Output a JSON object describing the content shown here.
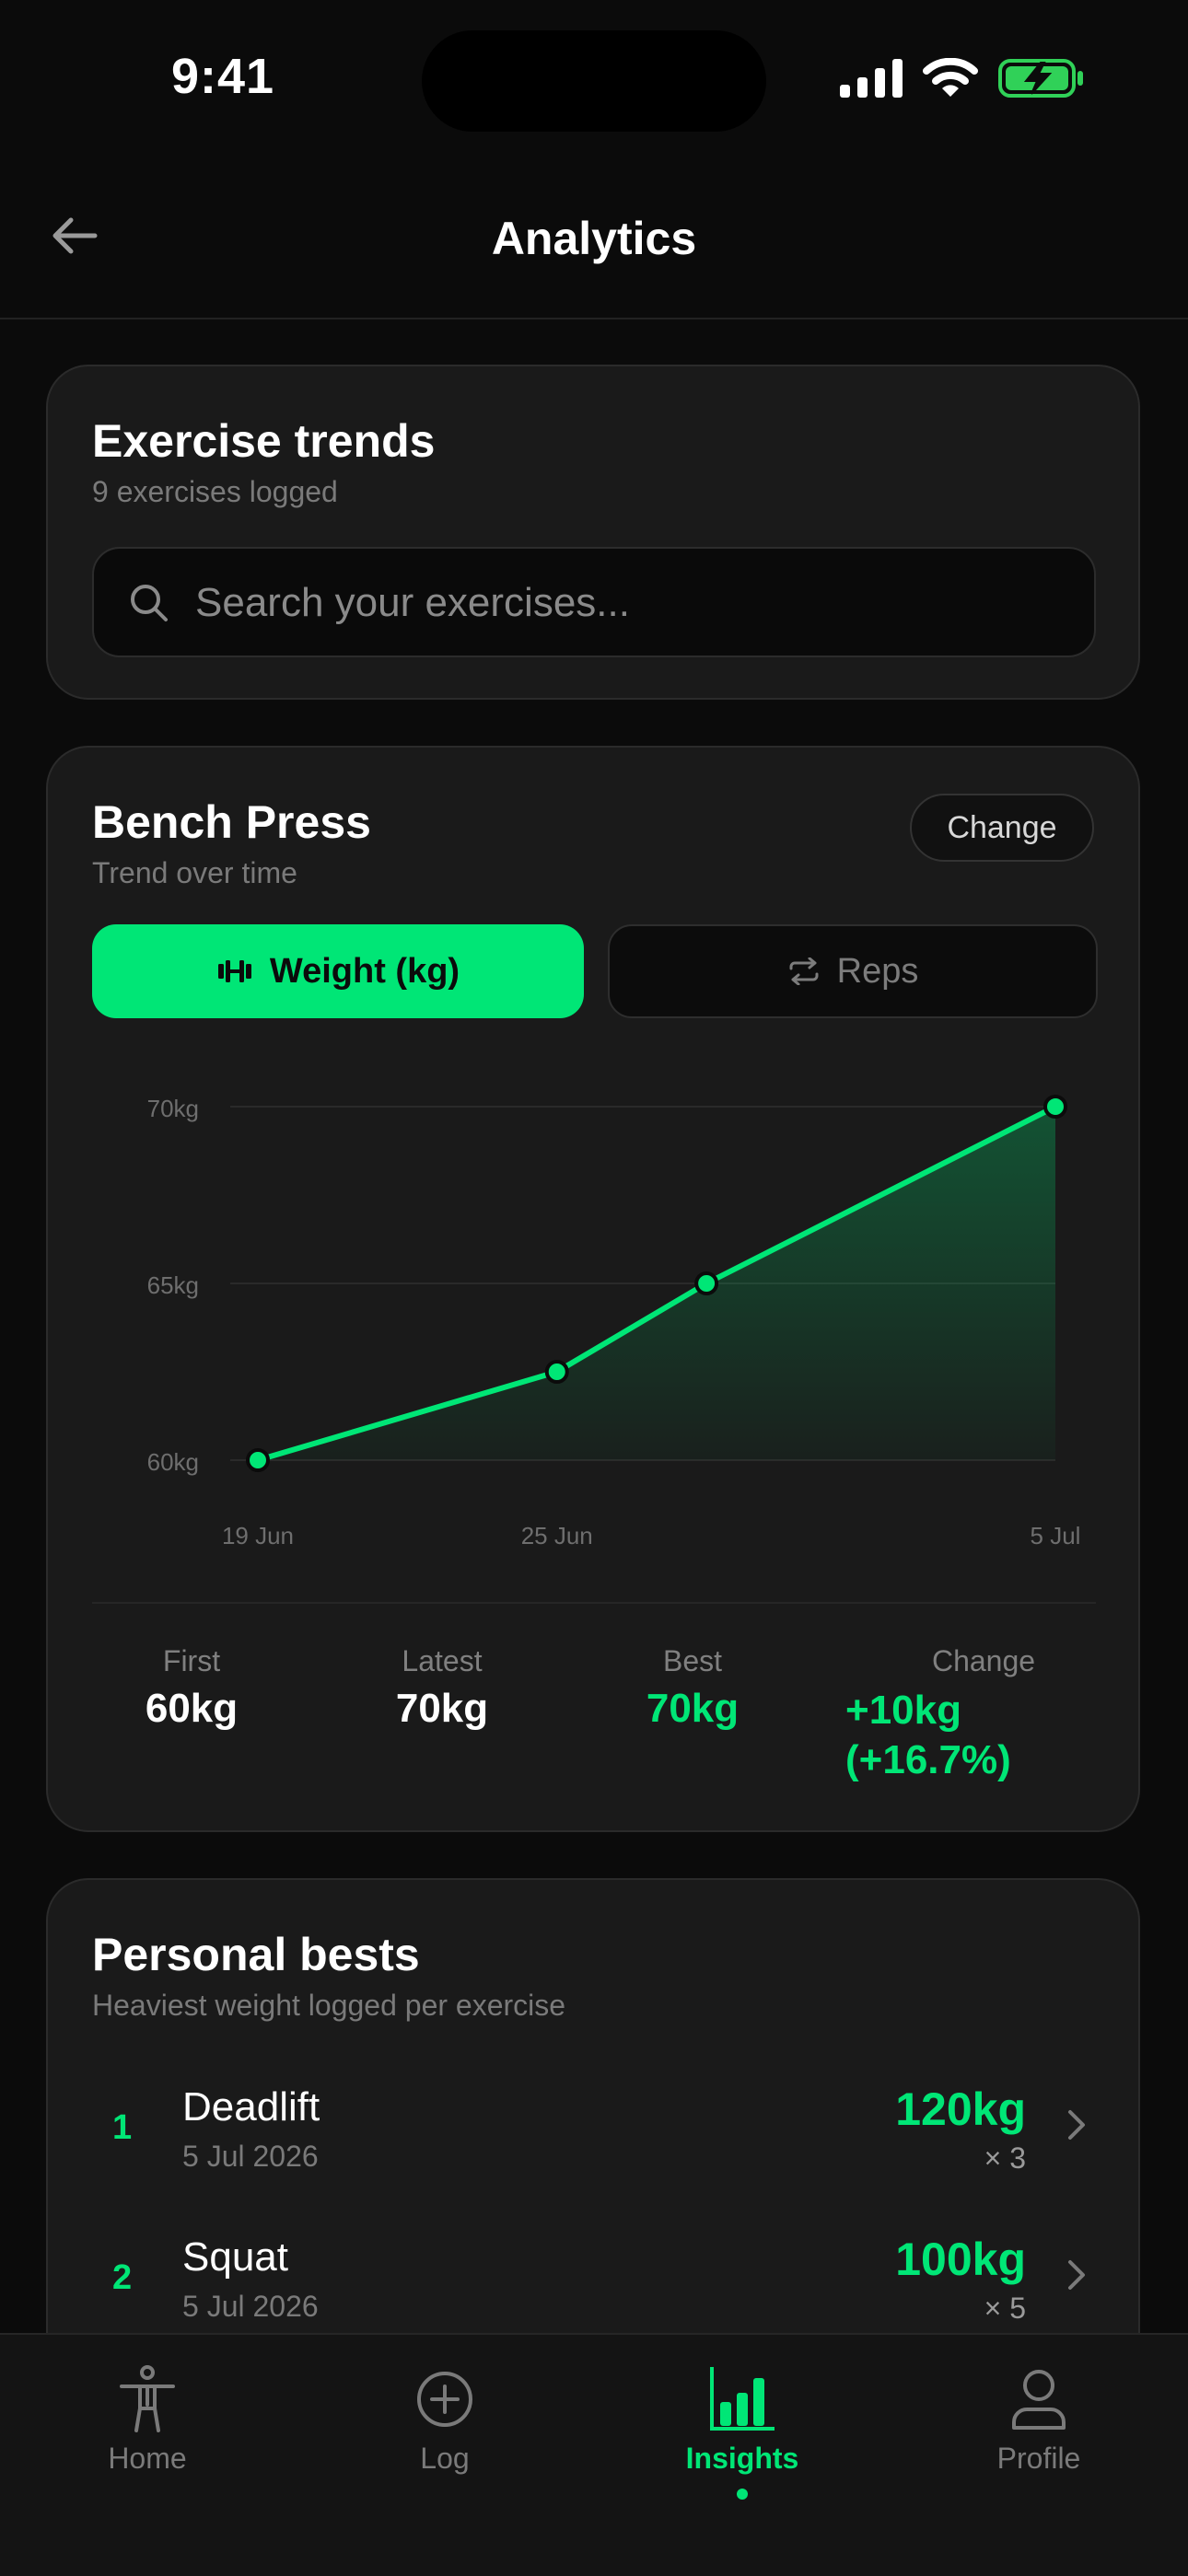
{
  "status_bar": {
    "time": "9:41"
  },
  "header": {
    "title": "Analytics"
  },
  "trends_card": {
    "title": "Exercise trends",
    "subtitle": "9 exercises logged",
    "search_placeholder": "Search your exercises..."
  },
  "exercise_card": {
    "title": "Bench Press",
    "subtitle": "Trend over time",
    "change_label": "Change",
    "metric_tabs": {
      "weight_label": "Weight (kg)",
      "reps_label": "Reps",
      "selected": "weight"
    },
    "stats": {
      "first_label": "First",
      "first_value": "60kg",
      "latest_label": "Latest",
      "latest_value": "70kg",
      "best_label": "Best",
      "best_value": "70kg",
      "change_label": "Change",
      "change_value_line1": "+10kg",
      "change_value_line2": "(+16.7%)"
    }
  },
  "chart_data": {
    "type": "line",
    "x": [
      "19 Jun",
      "25 Jun",
      "28 Jun",
      "5 Jul"
    ],
    "x_tick_labels": [
      "19 Jun",
      "25 Jun",
      "5 Jul"
    ],
    "values": [
      60,
      62.5,
      65,
      70
    ],
    "y_ticks": [
      "70kg",
      "65kg",
      "60kg"
    ],
    "ylim": [
      60,
      70
    ],
    "grid": true,
    "line_color": "#00e676",
    "fill": "area-gradient"
  },
  "personal_bests": {
    "title": "Personal bests",
    "subtitle": "Heaviest weight logged per exercise",
    "items": [
      {
        "rank": "1",
        "name": "Deadlift",
        "date": "5 Jul 2026",
        "weight": "120kg",
        "reps": "× 3"
      },
      {
        "rank": "2",
        "name": "Squat",
        "date": "5 Jul 2026",
        "weight": "100kg",
        "reps": "× 5"
      }
    ]
  },
  "tab_bar": {
    "items": [
      {
        "label": "Home",
        "icon": "person-icon"
      },
      {
        "label": "Log",
        "icon": "plus-circle-icon"
      },
      {
        "label": "Insights",
        "icon": "bar-chart-icon",
        "active": true
      },
      {
        "label": "Profile",
        "icon": "profile-icon"
      }
    ]
  },
  "colors": {
    "accent": "#00e676",
    "background": "#0b0b0b",
    "card": "#1a1a1a"
  }
}
